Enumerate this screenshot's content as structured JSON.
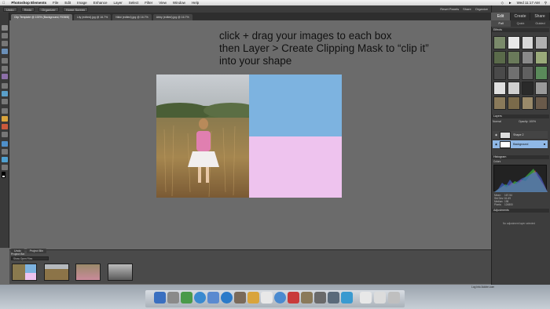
{
  "menubar": {
    "app": "Photoshop Elements",
    "items": [
      "File",
      "Edit",
      "Image",
      "Enhance",
      "Layer",
      "Select",
      "Filter",
      "View",
      "Window",
      "Help"
    ],
    "clock": "Wed 11:17 AM"
  },
  "appbar": {
    "buttons": [
      "Undo",
      "Redo",
      "Organizer",
      "Home Screen"
    ],
    "right": [
      "Reset Panels",
      "Share",
      "Organize"
    ]
  },
  "doc_tabs": [
    {
      "label": "Clip Template @ 100% (Background, RGB/8)",
      "active": true
    },
    {
      "label": "Lily (edited).jpg @ 16.7%",
      "active": false
    },
    {
      "label": "Nikki (edited).jpg @ 16.7%",
      "active": false
    },
    {
      "label": "Abby (edited).jpg @ 16.7%",
      "active": false
    }
  ],
  "instruction": {
    "line1": "click + drag your images to each box",
    "line2": "then Layer > Create Clipping Mask to “clip it”",
    "line3": "into your shape"
  },
  "colors": {
    "box_blue": "#7db3e0",
    "box_pink": "#eec3ee",
    "canvas_bg": "#6b6b6b",
    "selected_layer": "#8fb8e6"
  },
  "project_bin": {
    "tabs": [
      "Undo",
      "Project Bin"
    ],
    "label": "Project Bin",
    "select_value": "Show Open Files",
    "thumbnails": [
      "thumb-template",
      "thumb-field-girls",
      "thumb-pink-girl",
      "thumb-bw-kids"
    ]
  },
  "right_panel": {
    "tabs": [
      {
        "label": "Edit",
        "active": true
      },
      {
        "label": "Create",
        "active": false
      },
      {
        "label": "Share",
        "active": false
      }
    ],
    "subtabs": [
      {
        "label": "Full",
        "active": true
      },
      {
        "label": "Quick",
        "active": false
      },
      {
        "label": "Guided",
        "active": false
      }
    ],
    "effects_label": "Effects",
    "layers_label": "Layers",
    "blend_mode": "Normal",
    "opacity_label": "Opacity: 100%",
    "layers": [
      {
        "name": "Shape 2",
        "selected": false
      },
      {
        "name": "Background",
        "selected": true
      }
    ],
    "histogram_label": "Histogram",
    "histogram_channel": "Colors",
    "stats": {
      "mean_label": "Mean:",
      "mean": "167.54",
      "stddev_label": "Std Dev:",
      "stddev": "61.69",
      "median_label": "Median:",
      "median": "198",
      "pixels_label": "Pixels:",
      "pixels": "124800"
    },
    "adjustments_label": "Adjustments",
    "adjustments_hint": "No adjustment layer selected"
  },
  "status": "Log into Adobe.com"
}
